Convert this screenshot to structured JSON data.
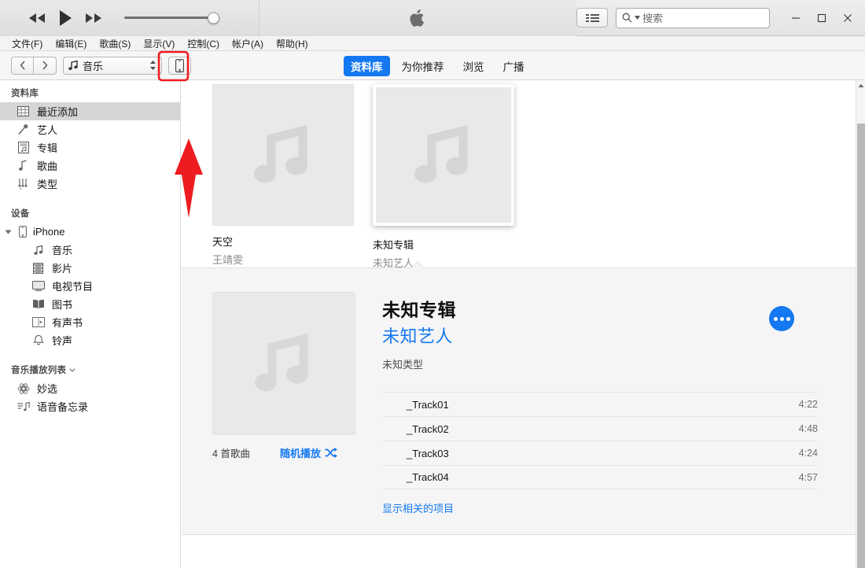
{
  "window": {
    "minimize_label": "—",
    "maximize_label": "□",
    "close_label": "✕"
  },
  "transport": {
    "rewind_icon": "rewind-icon",
    "play_icon": "play-icon",
    "forward_icon": "fast-forward-icon",
    "volume_icon": "volume-slider",
    "volume_value": "100"
  },
  "status_display": {
    "logo": "apple-logo"
  },
  "toolbar_right": {
    "list_view_icon": "list-view-icon",
    "search_icon": "search-icon",
    "search_placeholder": "搜索",
    "search_value": ""
  },
  "menubar": {
    "items": [
      {
        "label": "文件(F)"
      },
      {
        "label": "编辑(E)"
      },
      {
        "label": "歌曲(S)"
      },
      {
        "label": "显示(V)"
      },
      {
        "label": "控制(C)"
      },
      {
        "label": "帐户(A)"
      },
      {
        "label": "帮助(H)"
      }
    ]
  },
  "navbar": {
    "back_icon": "chevron-left-icon",
    "forward_icon": "chevron-right-icon",
    "media_picker": {
      "icon": "music-note-icon",
      "label": "音乐",
      "chevron": "chevron-up-down-icon"
    },
    "device_button": {
      "icon": "iphone-icon",
      "label": "iPhone"
    },
    "tabs": [
      {
        "label": "资料库",
        "active": true
      },
      {
        "label": "为你推荐",
        "active": false
      },
      {
        "label": "浏览",
        "active": false
      },
      {
        "label": "广播",
        "active": false
      }
    ]
  },
  "sidebar": {
    "library_header": "资料库",
    "library_items": [
      {
        "label": "最近添加",
        "icon": "grid-icon",
        "selected": true
      },
      {
        "label": "艺人",
        "icon": "microphone-icon",
        "selected": false
      },
      {
        "label": "专辑",
        "icon": "album-icon",
        "selected": false
      },
      {
        "label": "歌曲",
        "icon": "music-note-icon",
        "selected": false
      },
      {
        "label": "类型",
        "icon": "genre-icon",
        "selected": false
      }
    ],
    "devices_header": "设备",
    "device_name": "iPhone",
    "device_icon": "iphone-icon",
    "device_items": [
      {
        "label": "音乐",
        "icon": "music-note-icon"
      },
      {
        "label": "影片",
        "icon": "film-icon"
      },
      {
        "label": "电视节目",
        "icon": "tv-icon"
      },
      {
        "label": "图书",
        "icon": "book-icon"
      },
      {
        "label": "有声书",
        "icon": "audiobook-icon"
      },
      {
        "label": "铃声",
        "icon": "bell-icon"
      }
    ],
    "playlists_header": "音乐播放列表",
    "playlists_chevron": "chevron-down-icon",
    "playlist_items": [
      {
        "label": "妙选",
        "icon": "genius-icon"
      },
      {
        "label": "语音备忘录",
        "icon": "voice-memo-icon"
      }
    ]
  },
  "album_grid": [
    {
      "title": "天空",
      "artist": "王靖雯",
      "artwork_icon": "music-note-placeholder",
      "selected": false
    },
    {
      "title": "未知专辑",
      "artist": "未知艺人",
      "artwork_icon": "music-note-placeholder",
      "selected": true
    }
  ],
  "detail": {
    "artwork_icon": "music-note-placeholder",
    "song_count": "4 首歌曲",
    "shuffle_label": "随机播放",
    "shuffle_icon": "shuffle-icon",
    "album": "未知专辑",
    "artist": "未知艺人",
    "genre": "未知类型",
    "more_button": "more-options-icon",
    "tracks": [
      {
        "name": "_Track01",
        "time": "4:22"
      },
      {
        "name": "_Track02",
        "time": "4:48"
      },
      {
        "name": "_Track03",
        "time": "4:24"
      },
      {
        "name": "_Track04",
        "time": "4:57"
      }
    ],
    "show_related_label": "显示相关的项目"
  },
  "scrollbar": {
    "up_arrow": "chevron-up-icon",
    "thumb": "scrollbar-thumb"
  },
  "annotation": {
    "highlight_color": "#ee1c20",
    "target": "device-button"
  }
}
